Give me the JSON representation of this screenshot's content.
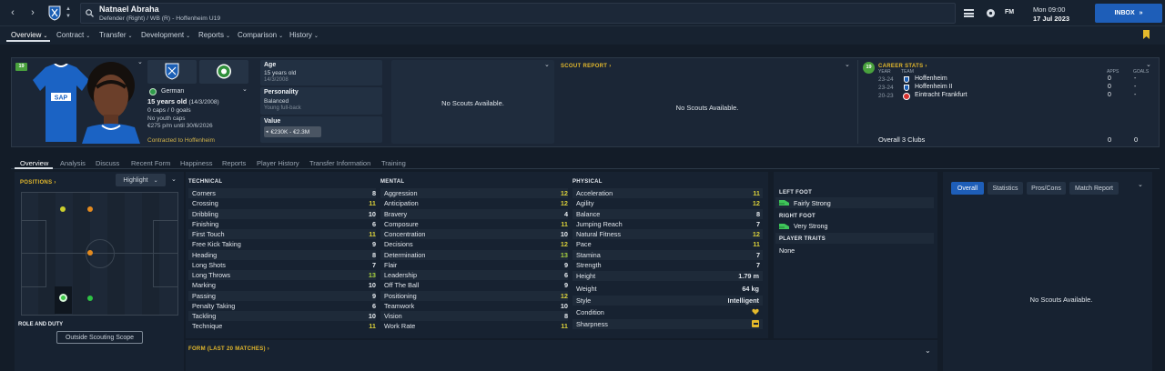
{
  "player": {
    "name": "Natnael Abraha",
    "subtitle": "Defender (Right) / WB (R) - Hoffenheim U19",
    "nationality": "German",
    "age_line": "15 years old",
    "dob_paren": "(14/3/2008)",
    "caps": "0 caps / 0 goals",
    "youth_caps": "No youth caps",
    "wage": "€275 p/m until 30/6/2026",
    "contract": "Contracted to Hoffenheim",
    "shirt_badge": "19"
  },
  "topbar": {
    "date_line1": "Mon 09:00",
    "date_line2": "17 Jul 2023",
    "inbox_label": "INBOX",
    "fm_label": "FM"
  },
  "nav": [
    "Overview",
    "Contract",
    "Transfer",
    "Development",
    "Reports",
    "Comparison",
    "History"
  ],
  "info": {
    "age_label": "Age",
    "age_value": "15 years old",
    "age_sub": "14/3/2008",
    "personality_label": "Personality",
    "personality_value": "Balanced",
    "personality_sub": "Young full-back",
    "value_label": "Value",
    "value_value": "€230K - €2.3M"
  },
  "scouts_panel": {
    "text": "No Scouts Available."
  },
  "scout_report": {
    "title": "SCOUT REPORT",
    "text": "No Scouts Available."
  },
  "career": {
    "title": "CAREER STATS",
    "badge": "19",
    "col_year": "YEAR",
    "col_team": "TEAM",
    "col_apps": "APPS",
    "col_goals": "GOALS",
    "rows": [
      {
        "year": "23-24",
        "team": "Hoffenheim",
        "apps": "0",
        "goals": "-"
      },
      {
        "year": "23-24",
        "team": "Hoffenheim II",
        "apps": "0",
        "goals": "-"
      },
      {
        "year": "20-23",
        "team": "Eintracht Frankfurt",
        "apps": "0",
        "goals": "-"
      }
    ],
    "overall_label": "Overall 3 Clubs",
    "overall_apps": "0",
    "overall_goals": "0"
  },
  "subtabs": [
    "Overview",
    "Analysis",
    "Discuss",
    "Recent Form",
    "Happiness",
    "Reports",
    "Player History",
    "Transfer Information",
    "Training"
  ],
  "positions": {
    "title": "POSITIONS",
    "highlight_label": "Highlight",
    "role_title": "ROLE AND DUTY",
    "role_button": "Outside Scouting Scope"
  },
  "technical": {
    "title": "TECHNICAL",
    "attrs": [
      {
        "name": "Corners",
        "value": "8"
      },
      {
        "name": "Crossing",
        "value": "11"
      },
      {
        "name": "Dribbling",
        "value": "10"
      },
      {
        "name": "Finishing",
        "value": "6"
      },
      {
        "name": "First Touch",
        "value": "11"
      },
      {
        "name": "Free Kick Taking",
        "value": "9"
      },
      {
        "name": "Heading",
        "value": "8"
      },
      {
        "name": "Long Shots",
        "value": "7"
      },
      {
        "name": "Long Throws",
        "value": "13"
      },
      {
        "name": "Marking",
        "value": "10"
      },
      {
        "name": "Passing",
        "value": "9"
      },
      {
        "name": "Penalty Taking",
        "value": "6"
      },
      {
        "name": "Tackling",
        "value": "10"
      },
      {
        "name": "Technique",
        "value": "11"
      }
    ]
  },
  "mental": {
    "title": "MENTAL",
    "attrs": [
      {
        "name": "Aggression",
        "value": "12"
      },
      {
        "name": "Anticipation",
        "value": "12"
      },
      {
        "name": "Bravery",
        "value": "4"
      },
      {
        "name": "Composure",
        "value": "11"
      },
      {
        "name": "Concentration",
        "value": "10"
      },
      {
        "name": "Decisions",
        "value": "12"
      },
      {
        "name": "Determination",
        "value": "13"
      },
      {
        "name": "Flair",
        "value": "9"
      },
      {
        "name": "Leadership",
        "value": "6"
      },
      {
        "name": "Off The Ball",
        "value": "9"
      },
      {
        "name": "Positioning",
        "value": "12"
      },
      {
        "name": "Teamwork",
        "value": "10"
      },
      {
        "name": "Vision",
        "value": "8"
      },
      {
        "name": "Work Rate",
        "value": "11"
      }
    ]
  },
  "physical": {
    "title": "PHYSICAL",
    "attrs": [
      {
        "name": "Acceleration",
        "value": "11"
      },
      {
        "name": "Agility",
        "value": "12"
      },
      {
        "name": "Balance",
        "value": "8"
      },
      {
        "name": "Jumping Reach",
        "value": "7"
      },
      {
        "name": "Natural Fitness",
        "value": "12"
      },
      {
        "name": "Pace",
        "value": "11"
      },
      {
        "name": "Stamina",
        "value": "7"
      },
      {
        "name": "Strength",
        "value": "7"
      }
    ],
    "height_label": "Height",
    "height_value": "1.79 m",
    "weight_label": "Weight",
    "weight_value": "64 kg",
    "style_label": "Style",
    "style_value": "Intelligent",
    "condition_label": "Condition",
    "sharpness_label": "Sharpness"
  },
  "feet": {
    "left_title": "LEFT FOOT",
    "left_value": "Fairly Strong",
    "right_title": "RIGHT FOOT",
    "right_value": "Very Strong",
    "traits_title": "PLAYER TRAITS",
    "traits_value": "None"
  },
  "form": {
    "title": "FORM (LAST 20 MATCHES)"
  },
  "report_tabs": [
    "Overall",
    "Statistics",
    "Pros/Cons",
    "Match Report"
  ],
  "report_panel": {
    "text": "No Scouts Available."
  },
  "colors": {
    "accent_yellow": "#e4b92c",
    "attr_green": "#8fd14f",
    "attr_yellow": "#d9cf3a",
    "attr_white": "#e8ecf0",
    "inbox_blue": "#1e5eb8"
  }
}
